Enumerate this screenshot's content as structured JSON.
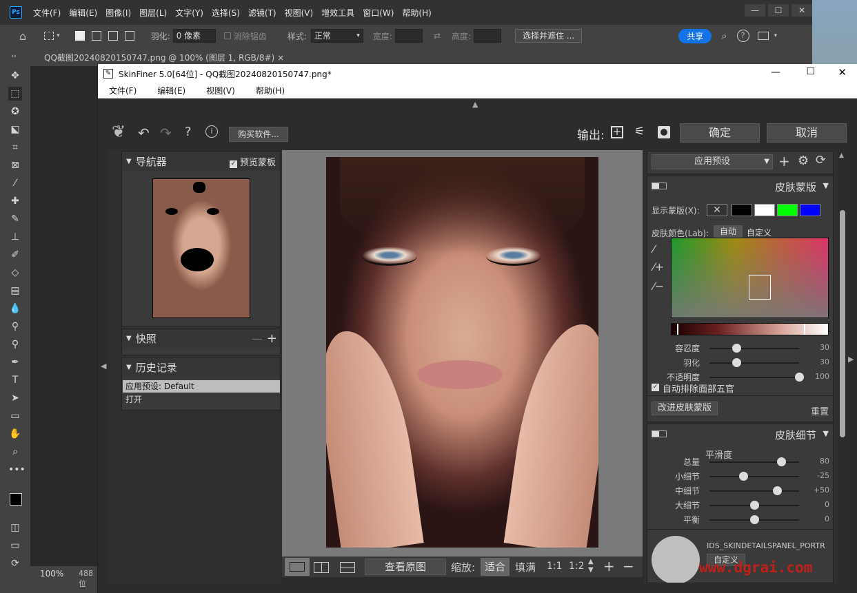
{
  "photoshop": {
    "menu": [
      "文件(F)",
      "编辑(E)",
      "图像(I)",
      "图层(L)",
      "文字(Y)",
      "选择(S)",
      "滤镜(T)",
      "视图(V)",
      "增效工具",
      "窗口(W)",
      "帮助(H)"
    ],
    "options": {
      "feather_label": "羽化:",
      "feather_value": "0 像素",
      "antialias_label": "消除锯齿",
      "style_label": "样式:",
      "style_value": "正常",
      "width_label": "宽度:",
      "height_label": "高度:",
      "select_mask_button": "选择并遮住 ...",
      "share_button": "共享"
    },
    "doc_tab": "QQ截图20240820150747.png @ 100% (图层 1, RGB/8#)",
    "zoom": "100%",
    "status_partial": "488 位"
  },
  "skinfiner": {
    "title": "SkinFiner 5.0[64位] - QQ截图20240820150747.png*",
    "menu": [
      "文件(F)",
      "编辑(E)",
      "视图(V)",
      "帮助(H)"
    ],
    "toolbar": {
      "buy_button": "购买软件...",
      "output_label": "输出:",
      "ok_button": "确定",
      "cancel_button": "取消"
    },
    "navigator": {
      "title": "导航器",
      "preview_mask_label": "预览蒙板",
      "preview_mask_checked": true
    },
    "snapshot": {
      "title": "快照"
    },
    "history": {
      "title": "历史记录",
      "items": [
        "应用预设: Default",
        "打开"
      ]
    },
    "bottom_bar": {
      "view_original_button": "查看原图",
      "zoom_label": "缩放:",
      "fit_button": "适合",
      "fill_button": "填满",
      "one_to_one": "1:1",
      "one_to_two": "1:2"
    },
    "right": {
      "preset_dropdown": "应用预设",
      "skin_mask": {
        "title": "皮肤蒙版",
        "show_mask_label": "显示蒙版(X):",
        "swatch_colors": [
          "#000000",
          "#ffffff",
          "#00ff00",
          "#0000ff"
        ],
        "skin_color_label": "皮肤颜色(Lab):",
        "auto_button": "自动",
        "custom_button": "自定义",
        "sliders": [
          {
            "label": "容忍度",
            "value": "30",
            "level": 0.3
          },
          {
            "label": "羽化",
            "value": "30",
            "level": 0.3
          },
          {
            "label": "不透明度",
            "value": "100",
            "level": 1.0
          }
        ],
        "exclude_label": "自动排除面部五官",
        "exclude_checked": true,
        "improve_button": "改进皮肤蒙版",
        "reset_label": "重置"
      },
      "skin_detail": {
        "title": "皮肤细节",
        "smoothness_label": "平滑度",
        "sliders": [
          {
            "label": "总量",
            "value": "80",
            "level": 0.8
          },
          {
            "label": "小细节",
            "value": "-25",
            "level": 0.375
          },
          {
            "label": "中细节",
            "value": "+50",
            "level": 0.75
          },
          {
            "label": "大细节",
            "value": "0",
            "level": 0.5
          },
          {
            "label": "平衡",
            "value": "0",
            "level": 0.5
          }
        ],
        "portrait_label": "IDS_SKINDETAILSPANEL_PORTR",
        "portrait_custom": "自定义"
      }
    }
  },
  "watermark": "www.dgrai.com"
}
